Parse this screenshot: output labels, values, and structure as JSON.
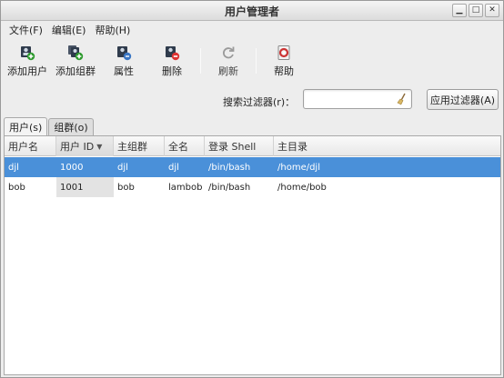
{
  "window": {
    "title": "用户管理者"
  },
  "menu": [
    "文件(F)",
    "编辑(E)",
    "帮助(H)"
  ],
  "toolbar": {
    "add_user": "添加用户",
    "add_group": "添加组群",
    "properties": "属性",
    "delete": "删除",
    "refresh": "刷新",
    "help": "帮助"
  },
  "search": {
    "label": "搜索过滤器(r)：",
    "value": "",
    "apply": "应用过滤器(A)"
  },
  "tabs": [
    "用户(s)",
    "组群(o)"
  ],
  "table": {
    "columns": [
      "用户名",
      "用户 ID",
      "主组群",
      "全名",
      "登录 Shell",
      "主目录"
    ],
    "rows": [
      [
        "djl",
        "1000",
        "djl",
        "djl",
        "/bin/bash",
        "/home/djl"
      ],
      [
        "bob",
        "1001",
        "bob",
        "lambob",
        "/bin/bash",
        "/home/bob"
      ]
    ]
  }
}
